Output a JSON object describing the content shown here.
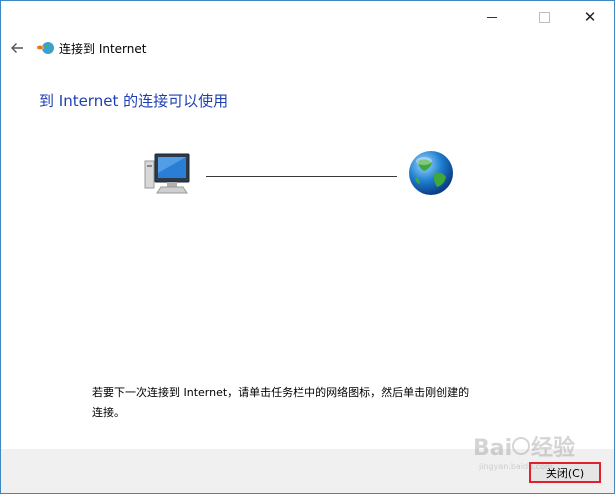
{
  "window": {
    "title": "连接到 Internet",
    "controls": {
      "minimize_icon": "minimize-icon",
      "maximize_icon": "maximize-icon",
      "close_icon": "close-icon"
    }
  },
  "nav": {
    "back_icon": "back-arrow-icon"
  },
  "main": {
    "heading": "到 Internet 的连接可以使用",
    "info_text": "若要下一次连接到 Internet，请单击任务栏中的网络图标，然后单击刚创建的连接。"
  },
  "footer": {
    "close_label": "关闭(C)"
  },
  "watermark": {
    "text": "Baidu 经验"
  },
  "colors": {
    "heading": "#1e3fb3",
    "window_border": "#3c88c4",
    "highlight": "#e0202a"
  }
}
